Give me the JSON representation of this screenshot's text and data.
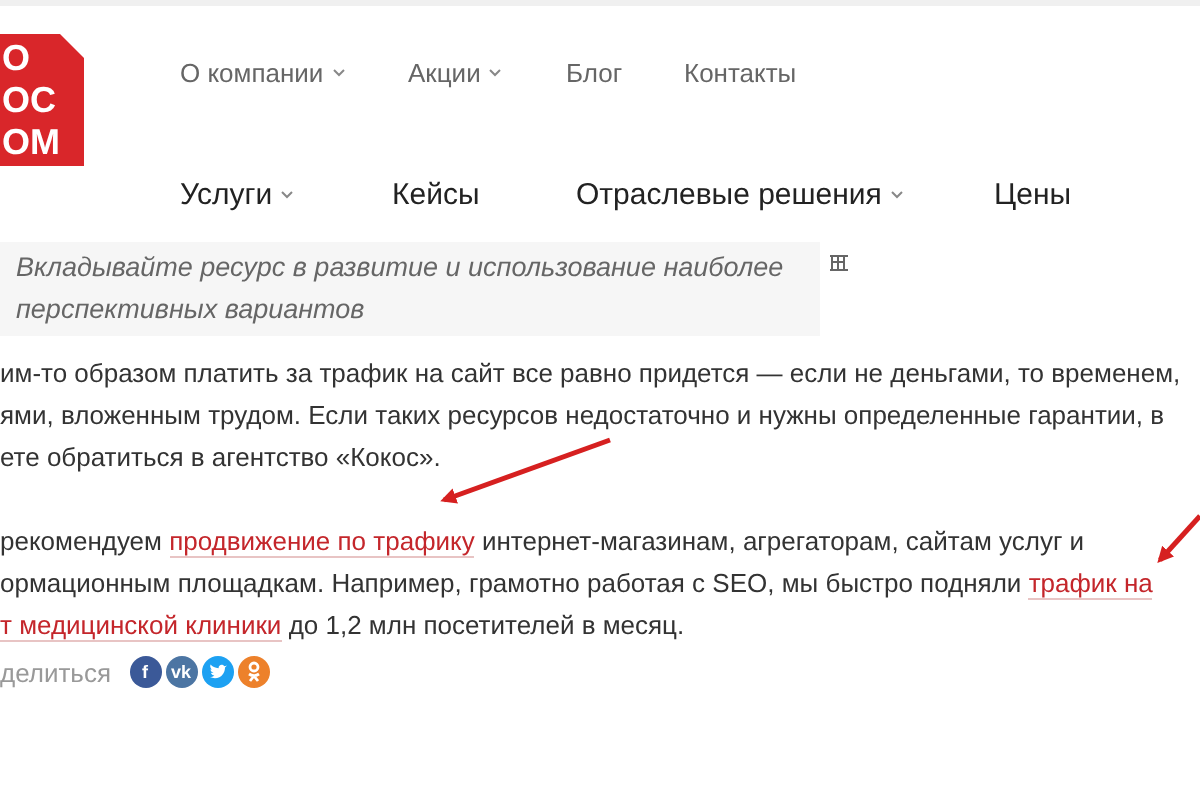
{
  "logo": {
    "lines": [
      "О",
      "ОС",
      "ОМ"
    ]
  },
  "top_menu": [
    {
      "label": "О компании",
      "dropdown": true
    },
    {
      "label": "Акции",
      "dropdown": true
    },
    {
      "label": "Блог",
      "dropdown": false
    },
    {
      "label": "Контакты",
      "dropdown": false
    }
  ],
  "main_menu": [
    {
      "label": "Услуги",
      "dropdown": true
    },
    {
      "label": "Кейсы",
      "dropdown": false
    },
    {
      "label": "Отраслевые решения",
      "dropdown": true
    },
    {
      "label": "Цены",
      "dropdown": false
    }
  ],
  "quote": {
    "lines": [
      "Вкладывайте ресурс в развитие и использование наиболее",
      "перспективных вариантов"
    ]
  },
  "paragraphs": [
    {
      "lines": [
        [
          {
            "text": "им-то образом платить за трафик на сайт все равно придется — если не деньгами, то временем,",
            "link": false
          }
        ],
        [
          {
            "text": "ями, вложенным трудом. Если таких ресурсов недостаточно и нужны определенные гарантии, в",
            "link": false
          }
        ],
        [
          {
            "text": "ете обратиться в агентство «Кокос».",
            "link": false
          }
        ]
      ]
    },
    {
      "lines": [
        [
          {
            "text": "рекомендуем ",
            "link": false
          },
          {
            "text": "продвижение по трафику",
            "link": true
          },
          {
            "text": " интернет-магазинам, агрегаторам, сайтам услуг и",
            "link": false
          }
        ],
        [
          {
            "text": "ормационным площадкам. Например, грамотно работая с SEO, мы быстро подняли ",
            "link": false
          },
          {
            "text": "трафик на",
            "link": true
          }
        ],
        [
          {
            "text": "т медицинской клиники",
            "link": true
          },
          {
            "text": " до 1,2 млн посетителей в месяц.",
            "link": false
          }
        ]
      ]
    }
  ],
  "share": {
    "label": "делиться",
    "buttons": [
      {
        "kind": "glyph",
        "glyph": "f",
        "color": "#3b5998"
      },
      {
        "kind": "glyph",
        "glyph": "vk",
        "color": "#4c75a3"
      },
      {
        "kind": "bird",
        "color": "#1da1f2"
      },
      {
        "kind": "ok",
        "color": "#ed812b"
      }
    ]
  }
}
